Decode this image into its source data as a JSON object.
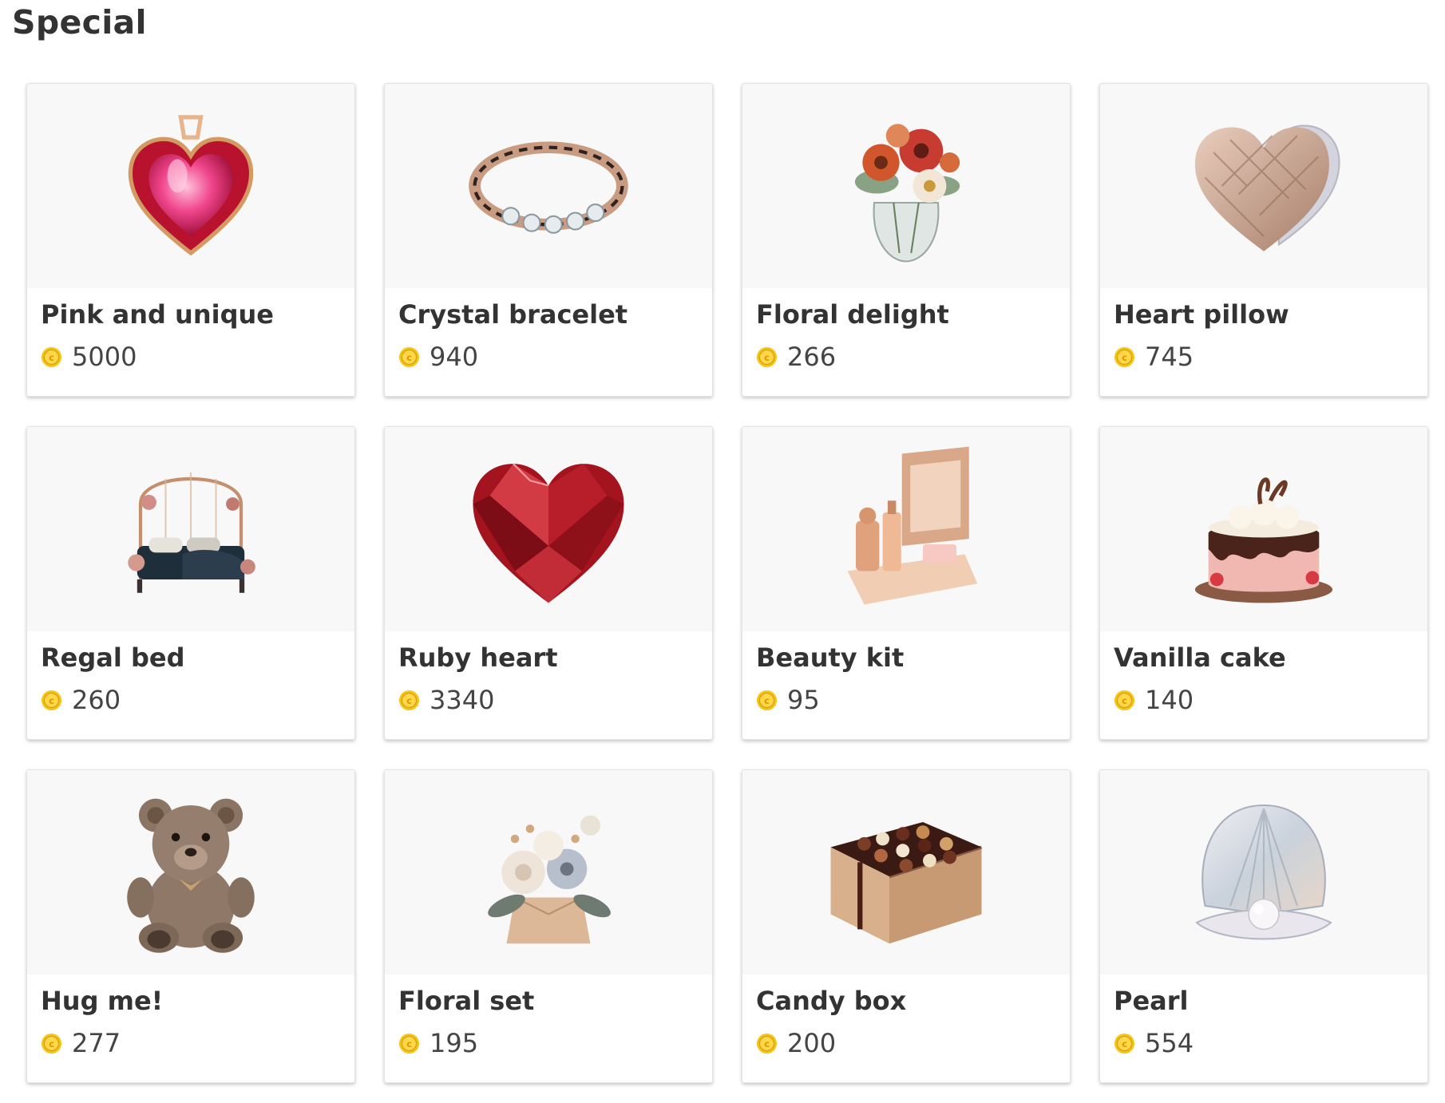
{
  "section": {
    "title": "Special"
  },
  "currency_icon": "gold-coin-icon",
  "items": [
    {
      "name": "Pink and unique",
      "price": "5000",
      "icon": "pink-heart-pendant-icon"
    },
    {
      "name": "Crystal bracelet",
      "price": "940",
      "icon": "crystal-bracelet-icon"
    },
    {
      "name": "Floral delight",
      "price": "266",
      "icon": "flower-vase-icon"
    },
    {
      "name": "Heart pillow",
      "price": "745",
      "icon": "heart-pillow-icon"
    },
    {
      "name": "Regal bed",
      "price": "260",
      "icon": "canopy-bed-icon"
    },
    {
      "name": "Ruby heart",
      "price": "3340",
      "icon": "ruby-heart-icon"
    },
    {
      "name": "Beauty kit",
      "price": "95",
      "icon": "beauty-kit-icon"
    },
    {
      "name": "Vanilla cake",
      "price": "140",
      "icon": "cake-icon"
    },
    {
      "name": "Hug me!",
      "price": "277",
      "icon": "teddy-bear-icon"
    },
    {
      "name": "Floral set",
      "price": "195",
      "icon": "flower-box-icon"
    },
    {
      "name": "Candy box",
      "price": "200",
      "icon": "chocolate-box-icon"
    },
    {
      "name": "Pearl",
      "price": "554",
      "icon": "pearl-shell-icon"
    }
  ]
}
